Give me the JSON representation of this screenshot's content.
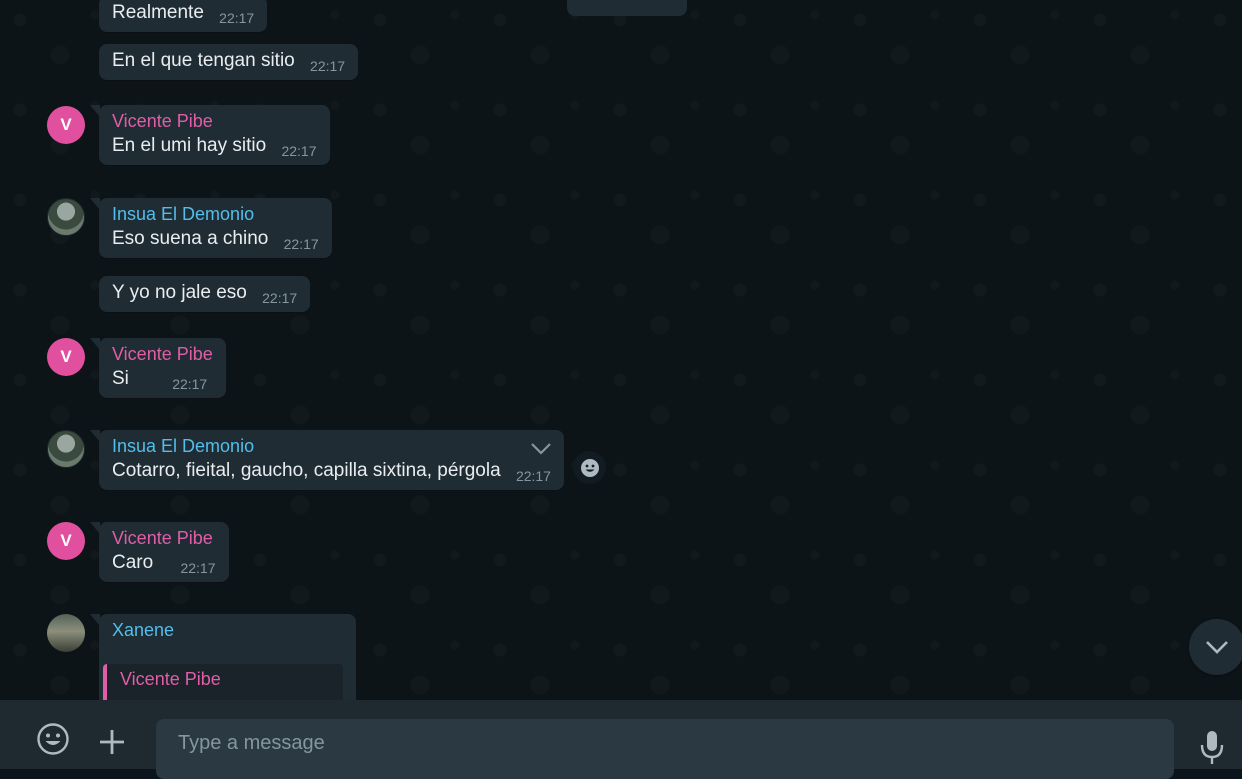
{
  "messages": [
    {
      "sender": "",
      "text": "Realmente",
      "time": "22:17"
    },
    {
      "sender": "",
      "text": "En el que tengan sitio",
      "time": "22:17"
    },
    {
      "sender": "Vicente Pibe",
      "avatar_letter": "V",
      "text": "En el umi hay sitio",
      "time": "22:17"
    },
    {
      "sender": "Insua El Demonio",
      "text": "Eso suena a chino",
      "time": "22:17"
    },
    {
      "sender": "",
      "text": "Y yo no jale eso",
      "time": "22:17"
    },
    {
      "sender": "Vicente Pibe",
      "avatar_letter": "V",
      "text": "Si",
      "time": "22:17"
    },
    {
      "sender": "Insua El Demonio",
      "text": "Cotarro, fieital, gaucho, capilla sixtina, pérgola",
      "time": "22:17"
    },
    {
      "sender": "Vicente Pibe",
      "avatar_letter": "V",
      "text": "Caro",
      "time": "22:17"
    },
    {
      "sender": "Xanene",
      "text": "",
      "time": "",
      "quoted_sender": "Vicente Pibe"
    }
  ],
  "composer": {
    "placeholder": "Type a message"
  },
  "icons": {
    "emoji": "emoji-icon",
    "attach": "plus-icon",
    "mic": "microphone-icon",
    "scroll": "chevron-down-icon",
    "menu": "chevron-down-icon",
    "react": "smiley-icon"
  },
  "colors": {
    "sender_pink": "#e05ea8",
    "sender_blue": "#53bdeb",
    "bubble": "#1f2c34",
    "timestamp": "#8696a0"
  }
}
